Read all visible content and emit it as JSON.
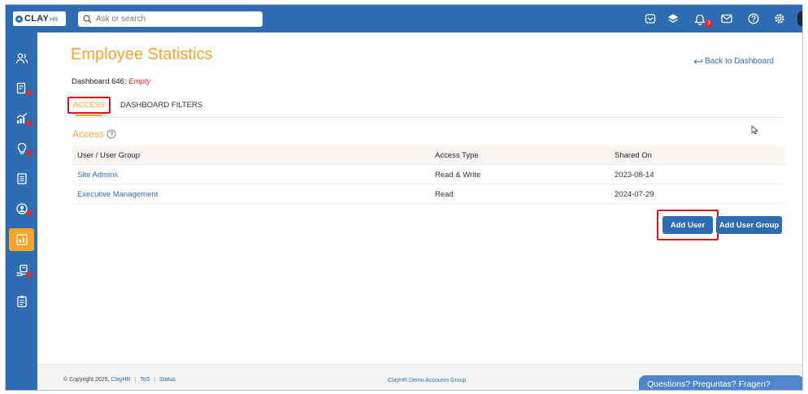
{
  "topbar": {
    "logo_text": "CLAY",
    "logo_suffix": "HR",
    "search_placeholder": "Ask or search",
    "notification_count": "3",
    "icons": [
      "inbox-icon",
      "layers-icon",
      "bell-icon",
      "mail-icon",
      "help-icon",
      "settings-icon"
    ]
  },
  "sidebar": {
    "items": [
      {
        "icon": "people-icon",
        "badge": false
      },
      {
        "icon": "document-gear-icon",
        "badge": true
      },
      {
        "icon": "chart-icon",
        "badge": true
      },
      {
        "icon": "lightbulb-icon",
        "badge": true
      },
      {
        "icon": "files-icon",
        "badge": false
      },
      {
        "icon": "user-circle-icon",
        "badge": true
      },
      {
        "icon": "dashboard-icon",
        "badge": false,
        "active": true
      },
      {
        "icon": "hand-card-icon",
        "badge": true
      },
      {
        "icon": "clipboard-icon",
        "badge": false
      }
    ],
    "active_color": "#f6a42a"
  },
  "page": {
    "title": "Employee Statistics",
    "back_link": "Back to Dashboard",
    "dashboard_label": "Dashboard 646:",
    "dashboard_status": "Empty"
  },
  "tabs": [
    {
      "label": "ACCESS",
      "active": true
    },
    {
      "label": "DASHBOARD FILTERS",
      "active": false
    }
  ],
  "access": {
    "section_title": "Access",
    "columns": [
      "User / User Group",
      "Access Type",
      "Shared On"
    ],
    "rows": [
      {
        "name": "Site Admins",
        "access_type": "Read & Write",
        "shared_on": "2023-08-14"
      },
      {
        "name": "Executive Management",
        "access_type": "Read",
        "shared_on": "2024-07-29"
      }
    ],
    "add_user_label": "Add User",
    "add_group_label": "Add User Group"
  },
  "footer": {
    "copyright": "© Copyright 2025,",
    "company": "ClayHR",
    "tos": "ToS",
    "status": "Status",
    "center_text": "ClayHR Demo Accounts Group",
    "help_text": "Questions? Preguntas? Fragen?"
  },
  "colors": {
    "primary": "#2e6db4",
    "accent": "#f6a42a",
    "highlight": "#d9131a",
    "badge": "#e3292b"
  }
}
